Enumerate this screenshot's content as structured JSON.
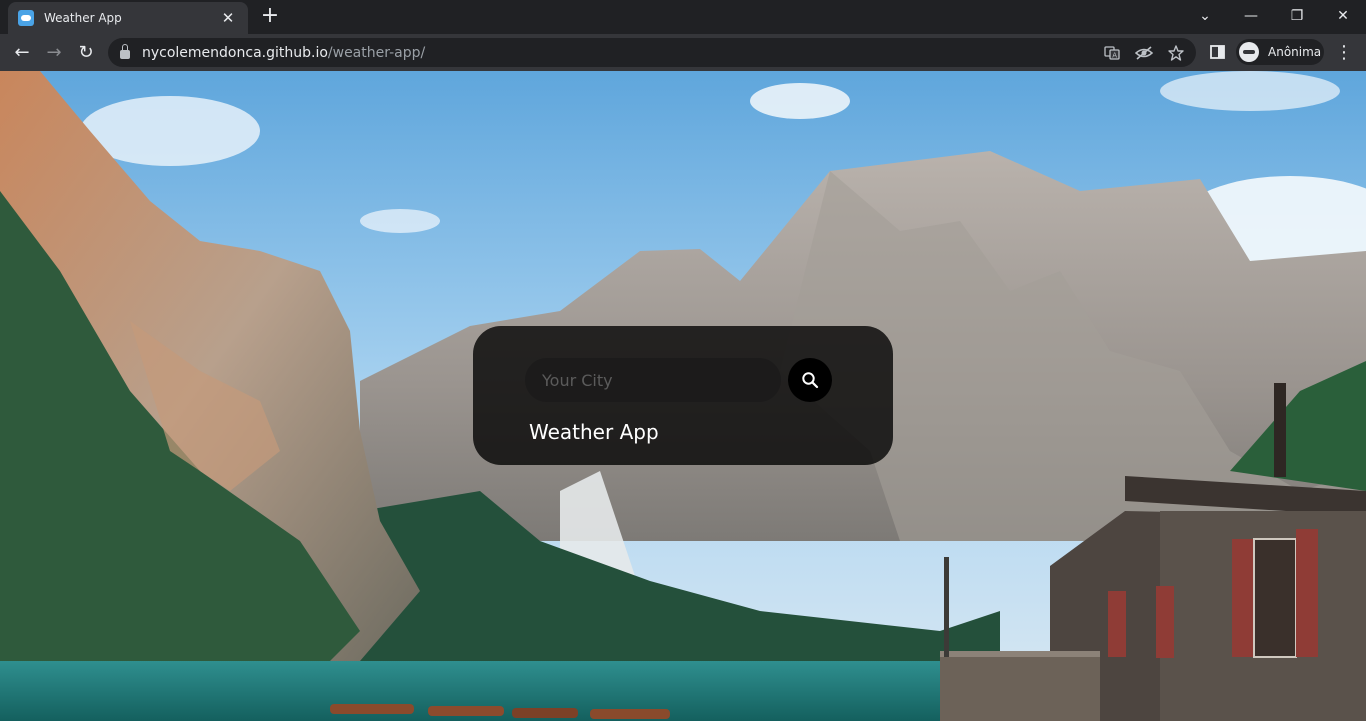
{
  "browser": {
    "tab": {
      "title": "Weather App",
      "close": "✕"
    },
    "new_tab": "+",
    "controls": {
      "tabs_list": "⌄",
      "minimize": "—",
      "restore": "❐",
      "close": "✕"
    },
    "nav": {
      "back": "←",
      "forward": "→",
      "reload": "↻"
    },
    "url": {
      "host": "nycolemendonca.github.io",
      "path": "/weather-app/"
    },
    "profile": {
      "label": "Anônima"
    },
    "menu": "⋮",
    "icons": [
      "lock-icon",
      "translate-icon",
      "eye-off-icon",
      "star-icon",
      "side-panel-icon",
      "incognito-icon"
    ]
  },
  "page": {
    "search": {
      "placeholder": "Your City",
      "value": ""
    },
    "title": "Weather App"
  }
}
